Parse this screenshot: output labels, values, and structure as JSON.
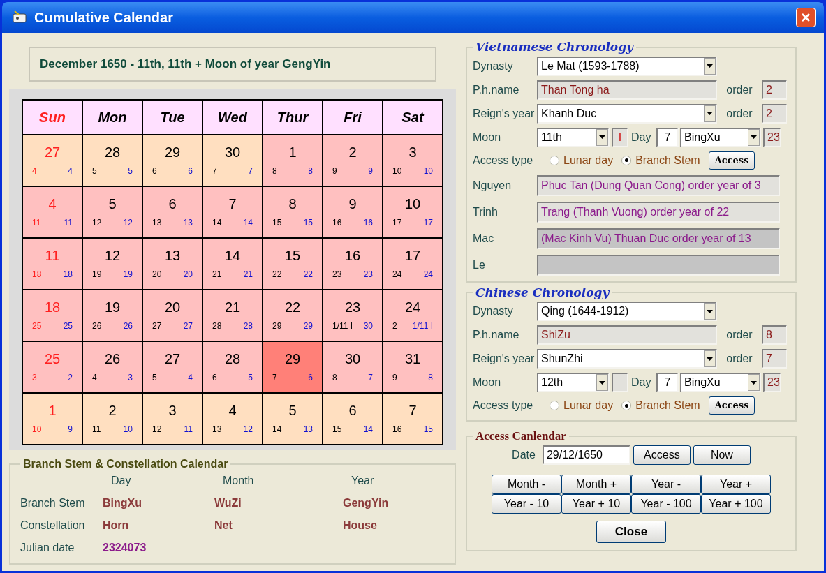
{
  "window": {
    "title": "Cumulative Calendar"
  },
  "heading": "December 1650 - 11th, 11th + Moon of year GengYin",
  "calendar": {
    "weekdays": [
      {
        "label": "Sun",
        "holiday": true
      },
      {
        "label": "Mon",
        "holiday": false
      },
      {
        "label": "Tue",
        "holiday": false
      },
      {
        "label": "Wed",
        "holiday": false
      },
      {
        "label": "Thur",
        "holiday": false
      },
      {
        "label": "Fri",
        "holiday": false
      },
      {
        "label": "Sat",
        "holiday": false
      }
    ],
    "weeks": [
      [
        {
          "day": "27",
          "lunar": "4",
          "stem": "4",
          "current": false,
          "selected": false
        },
        {
          "day": "28",
          "lunar": "5",
          "stem": "5",
          "current": false,
          "selected": false
        },
        {
          "day": "29",
          "lunar": "6",
          "stem": "6",
          "current": false,
          "selected": false
        },
        {
          "day": "30",
          "lunar": "7",
          "stem": "7",
          "current": false,
          "selected": false
        },
        {
          "day": "1",
          "lunar": "8",
          "stem": "8",
          "current": true,
          "selected": false
        },
        {
          "day": "2",
          "lunar": "9",
          "stem": "9",
          "current": true,
          "selected": false
        },
        {
          "day": "3",
          "lunar": "10",
          "stem": "10",
          "current": true,
          "selected": false
        }
      ],
      [
        {
          "day": "4",
          "lunar": "11",
          "stem": "11",
          "current": true,
          "selected": false
        },
        {
          "day": "5",
          "lunar": "12",
          "stem": "12",
          "current": true,
          "selected": false
        },
        {
          "day": "6",
          "lunar": "13",
          "stem": "13",
          "current": true,
          "selected": false
        },
        {
          "day": "7",
          "lunar": "14",
          "stem": "14",
          "current": true,
          "selected": false
        },
        {
          "day": "8",
          "lunar": "15",
          "stem": "15",
          "current": true,
          "selected": false
        },
        {
          "day": "9",
          "lunar": "16",
          "stem": "16",
          "current": true,
          "selected": false
        },
        {
          "day": "10",
          "lunar": "17",
          "stem": "17",
          "current": true,
          "selected": false
        }
      ],
      [
        {
          "day": "11",
          "lunar": "18",
          "stem": "18",
          "current": true,
          "selected": false
        },
        {
          "day": "12",
          "lunar": "19",
          "stem": "19",
          "current": true,
          "selected": false
        },
        {
          "day": "13",
          "lunar": "20",
          "stem": "20",
          "current": true,
          "selected": false
        },
        {
          "day": "14",
          "lunar": "21",
          "stem": "21",
          "current": true,
          "selected": false
        },
        {
          "day": "15",
          "lunar": "22",
          "stem": "22",
          "current": true,
          "selected": false
        },
        {
          "day": "16",
          "lunar": "23",
          "stem": "23",
          "current": true,
          "selected": false
        },
        {
          "day": "17",
          "lunar": "24",
          "stem": "24",
          "current": true,
          "selected": false
        }
      ],
      [
        {
          "day": "18",
          "lunar": "25",
          "stem": "25",
          "current": true,
          "selected": false
        },
        {
          "day": "19",
          "lunar": "26",
          "stem": "26",
          "current": true,
          "selected": false
        },
        {
          "day": "20",
          "lunar": "27",
          "stem": "27",
          "current": true,
          "selected": false
        },
        {
          "day": "21",
          "lunar": "28",
          "stem": "28",
          "current": true,
          "selected": false
        },
        {
          "day": "22",
          "lunar": "29",
          "stem": "29",
          "current": true,
          "selected": false
        },
        {
          "day": "23",
          "lunar": "1/11 I",
          "stem": "30",
          "current": true,
          "selected": false
        },
        {
          "day": "24",
          "lunar": "2",
          "stem": "1/11 I",
          "current": true,
          "selected": false
        }
      ],
      [
        {
          "day": "25",
          "lunar": "3",
          "stem": "2",
          "current": true,
          "selected": false
        },
        {
          "day": "26",
          "lunar": "4",
          "stem": "3",
          "current": true,
          "selected": false
        },
        {
          "day": "27",
          "lunar": "5",
          "stem": "4",
          "current": true,
          "selected": false
        },
        {
          "day": "28",
          "lunar": "6",
          "stem": "5",
          "current": true,
          "selected": false
        },
        {
          "day": "29",
          "lunar": "7",
          "stem": "6",
          "current": true,
          "selected": true
        },
        {
          "day": "30",
          "lunar": "8",
          "stem": "7",
          "current": true,
          "selected": false
        },
        {
          "day": "31",
          "lunar": "9",
          "stem": "8",
          "current": true,
          "selected": false
        }
      ],
      [
        {
          "day": "1",
          "lunar": "10",
          "stem": "9",
          "current": false,
          "selected": false
        },
        {
          "day": "2",
          "lunar": "11",
          "stem": "10",
          "current": false,
          "selected": false
        },
        {
          "day": "3",
          "lunar": "12",
          "stem": "11",
          "current": false,
          "selected": false
        },
        {
          "day": "4",
          "lunar": "13",
          "stem": "12",
          "current": false,
          "selected": false
        },
        {
          "day": "5",
          "lunar": "14",
          "stem": "13",
          "current": false,
          "selected": false
        },
        {
          "day": "6",
          "lunar": "15",
          "stem": "14",
          "current": false,
          "selected": false
        },
        {
          "day": "7",
          "lunar": "16",
          "stem": "15",
          "current": false,
          "selected": false
        }
      ]
    ]
  },
  "branch_stem_calendar": {
    "title": "Branch Stem & Constellation Calendar",
    "columns": [
      "Day",
      "Month",
      "Year"
    ],
    "rows": [
      {
        "label": "Branch Stem",
        "kind": "name",
        "values": [
          "BingXu",
          "WuZi",
          "GengYin"
        ]
      },
      {
        "label": "Constellation",
        "kind": "name",
        "values": [
          "Horn",
          "Net",
          "House"
        ]
      },
      {
        "label": "Julian date",
        "kind": "number",
        "values": [
          "2324073"
        ]
      }
    ]
  },
  "vietnamese": {
    "title": "Vietnamese Chronology",
    "dynasty": {
      "label": "Dynasty",
      "value": "Le Mat (1593-1788)"
    },
    "ph_name": {
      "label": "P.h.name",
      "value": "Than Tong ha",
      "order_label": "order",
      "order": "2"
    },
    "reign": {
      "label": "Reign's year",
      "value": "Khanh Duc",
      "order_label": "order",
      "order": "2"
    },
    "moon": {
      "label": "Moon",
      "value": "11th",
      "intercalary": "I",
      "day_label": "Day",
      "day": "7",
      "stem": "BingXu",
      "stem_number": "23"
    },
    "access_type": {
      "label": "Access type",
      "options": [
        {
          "label": "Lunar day",
          "selected": false
        },
        {
          "label": "Branch Stem",
          "selected": true
        }
      ],
      "button": "Access"
    },
    "lords": [
      {
        "label": "Nguyen",
        "value": "Phuc Tan (Dung Quan Cong) order year of 3",
        "disabled": false
      },
      {
        "label": "Trinh",
        "value": "Trang (Thanh Vuong) order year of 22",
        "disabled": false
      },
      {
        "label": "Mac",
        "value": "(Mac Kinh Vu) Thuan Duc order year of 13",
        "disabled": true
      },
      {
        "label": "Le",
        "disabled": true
      }
    ]
  },
  "chinese": {
    "title": "Chinese Chronology",
    "dynasty": {
      "label": "Dynasty",
      "value": "Qing (1644-1912)"
    },
    "ph_name": {
      "label": "P.h.name",
      "value": "ShiZu",
      "order_label": "order",
      "order": "8"
    },
    "reign": {
      "label": "Reign's year",
      "value": "ShunZhi",
      "order_label": "order",
      "order": "7"
    },
    "moon": {
      "label": "Moon",
      "value": "12th",
      "day_label": "Day",
      "day": "7",
      "stem": "BingXu",
      "stem_number": "23"
    },
    "access_type": {
      "label": "Access type",
      "options": [
        {
          "label": "Lunar day",
          "selected": false
        },
        {
          "label": "Branch Stem",
          "selected": true
        }
      ],
      "button": "Access"
    }
  },
  "access_calendar": {
    "title": "Access Canlendar",
    "date_label": "Date",
    "date": "29/12/1650",
    "buttons": [
      "Access",
      "Now"
    ],
    "nav_buttons": [
      "Month -",
      "Month +",
      "Year -",
      "Year +",
      "Year - 10",
      "Year + 10",
      "Year - 100",
      "Year + 100"
    ],
    "close": "Close"
  }
}
